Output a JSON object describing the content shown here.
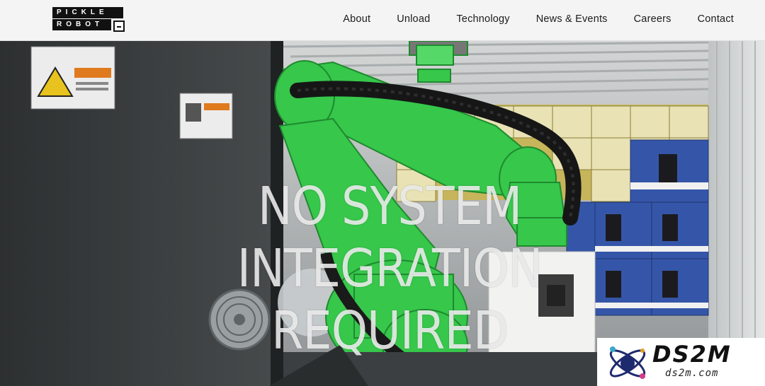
{
  "brand": {
    "logo_line1": "PICKLE",
    "logo_line2": "ROBOT"
  },
  "nav": {
    "items": [
      {
        "label": "About"
      },
      {
        "label": "Unload"
      },
      {
        "label": "Technology"
      },
      {
        "label": "News & Events"
      },
      {
        "label": "Careers"
      },
      {
        "label": "Contact"
      }
    ]
  },
  "hero": {
    "headline": [
      "NO SYSTEM",
      "INTEGRATION",
      "REQUIRED"
    ],
    "colors": {
      "robot_arm": "#37c84a",
      "machine": "#353839",
      "container": "#c9cbcc"
    }
  },
  "watermark": {
    "title": "DS2M",
    "subtitle": "ds2m.com"
  }
}
